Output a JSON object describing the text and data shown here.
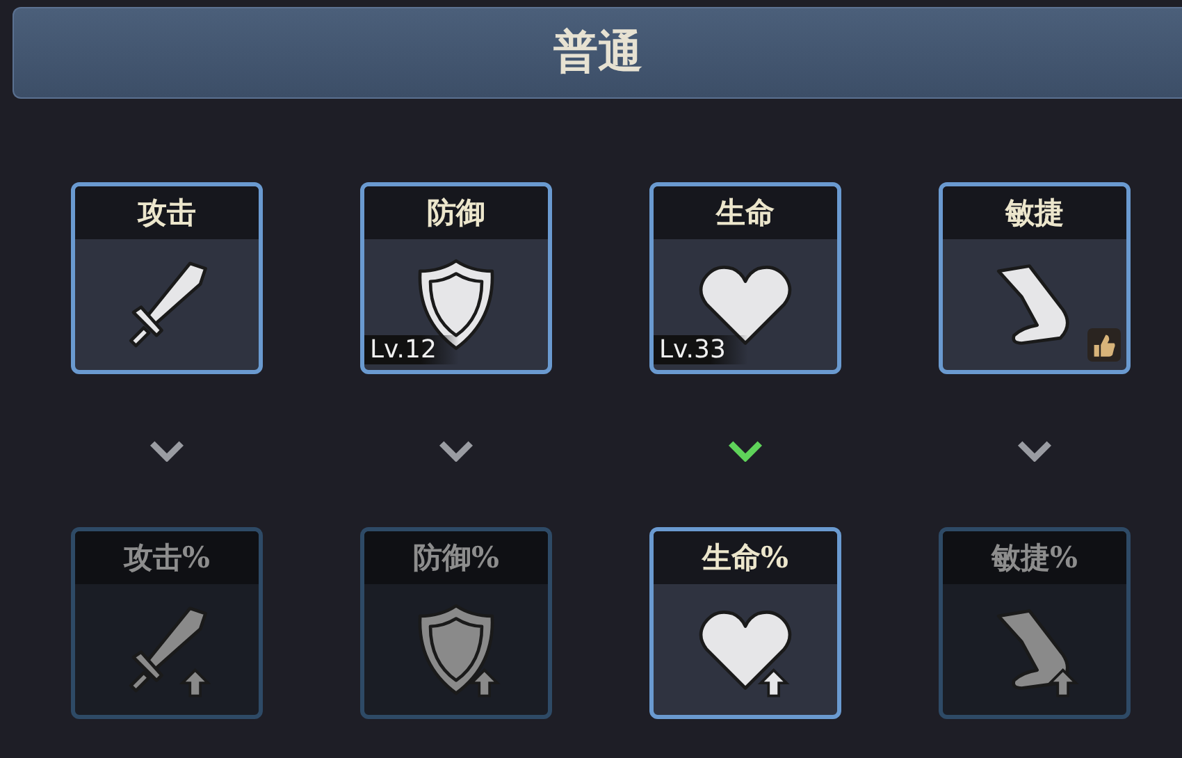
{
  "header": {
    "title": "普通"
  },
  "upper_cards": [
    {
      "label": "攻击",
      "kind": "sword",
      "recommended": false
    },
    {
      "label": "防御",
      "kind": "shield",
      "level_text": "Lv.12",
      "recommended": false
    },
    {
      "label": "生命",
      "kind": "heart",
      "level_text": "Lv.33",
      "recommended": false
    },
    {
      "label": "敏捷",
      "kind": "foot",
      "recommended": true
    }
  ],
  "connectors": [
    {
      "active": false
    },
    {
      "active": false
    },
    {
      "active": true
    },
    {
      "active": false
    }
  ],
  "lower_cards": [
    {
      "label": "攻击%",
      "kind": "sword",
      "unlocked": false
    },
    {
      "label": "防御%",
      "kind": "shield",
      "unlocked": false
    },
    {
      "label": "生命%",
      "kind": "heart",
      "unlocked": true
    },
    {
      "label": "敏捷%",
      "kind": "foot",
      "unlocked": false
    }
  ]
}
